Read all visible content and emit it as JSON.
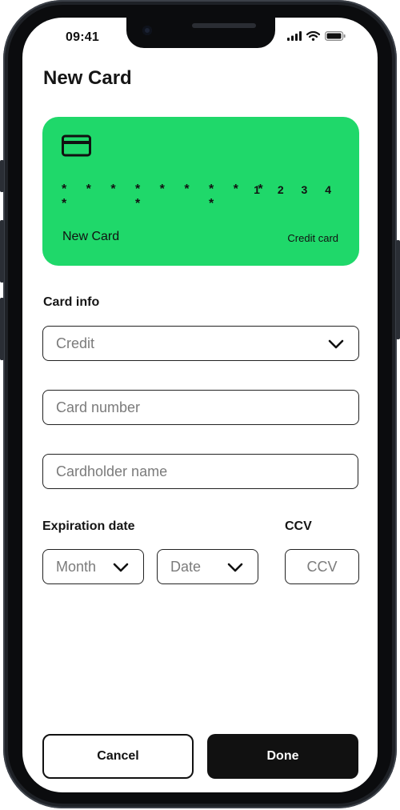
{
  "status_bar": {
    "time": "09:41",
    "signal_icon": "cellular-signal-icon",
    "wifi_icon": "wifi-icon",
    "battery_icon": "battery-icon"
  },
  "page": {
    "title": "New Card"
  },
  "card_preview": {
    "icon": "credit-card-icon",
    "masked_groups": [
      "* * * *",
      "* * * *",
      "* * * *"
    ],
    "last_digits": "1 2 3 4",
    "name": "New Card",
    "type": "Credit card",
    "color": "#1fd86a"
  },
  "card_info": {
    "label": "Card info",
    "type_select": {
      "value": "Credit"
    },
    "card_number": {
      "placeholder": "Card number"
    },
    "cardholder_name": {
      "placeholder": "Cardholder name"
    }
  },
  "expiration": {
    "label": "Expiration date",
    "month_select": {
      "value": "Month"
    },
    "date_select": {
      "value": "Date"
    }
  },
  "ccv": {
    "label": "CCV",
    "placeholder": "CCV"
  },
  "actions": {
    "cancel_label": "Cancel",
    "done_label": "Done"
  }
}
